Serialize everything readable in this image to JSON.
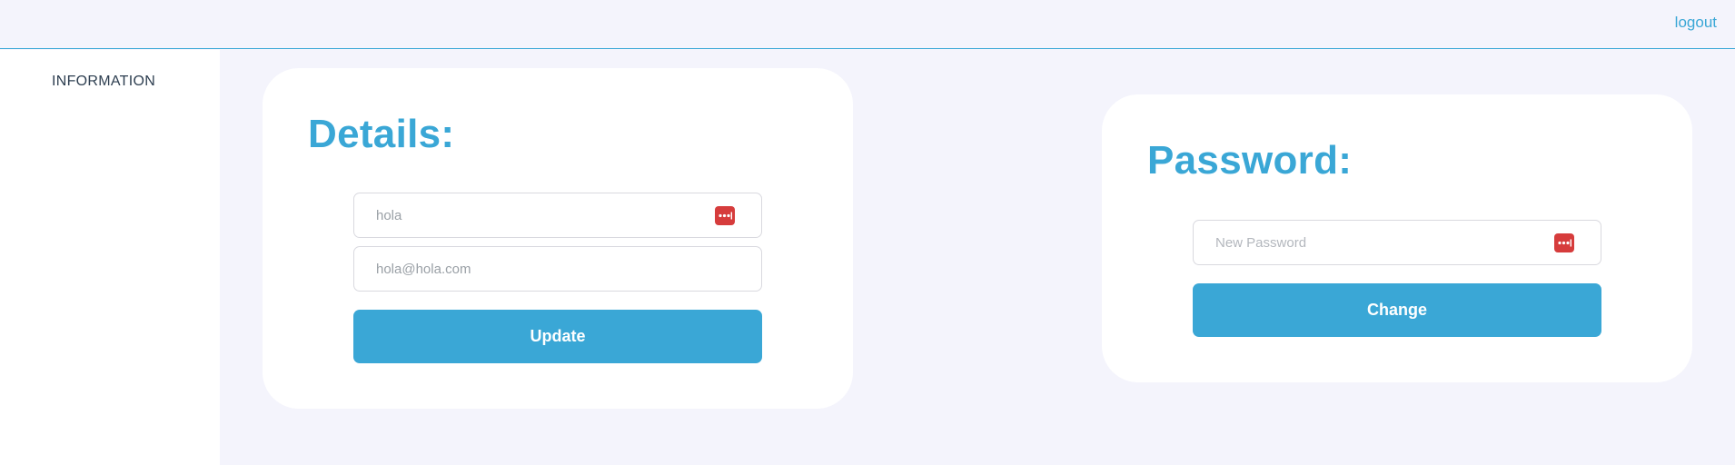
{
  "header": {
    "logout_label": "logout"
  },
  "sidebar": {
    "items": [
      {
        "label": "INFORMATION"
      }
    ]
  },
  "details": {
    "title": "Details:",
    "name_field": {
      "value": "hola"
    },
    "email_field": {
      "value": "hola@hola.com"
    },
    "update_label": "Update"
  },
  "password": {
    "title": "Password:",
    "new_password_field": {
      "placeholder": "New Password",
      "value": ""
    },
    "change_label": "Change"
  },
  "colors": {
    "accent": "#3aa7d6",
    "background": "#f4f4fc",
    "password_icon": "#d63c3c"
  },
  "icons": {
    "field_icon": "password-manager-icon"
  }
}
